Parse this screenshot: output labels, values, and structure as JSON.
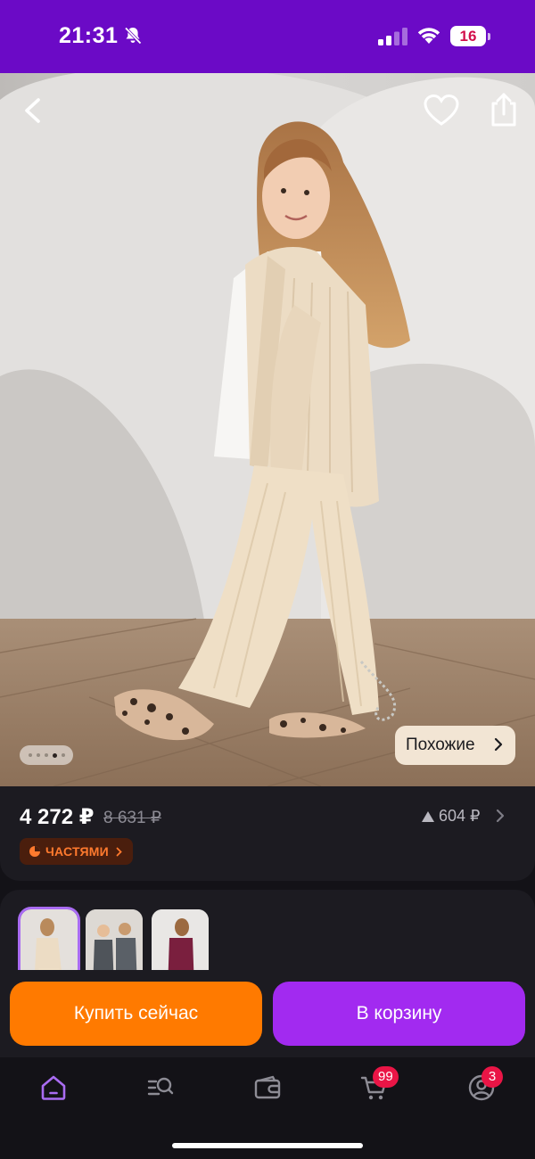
{
  "status_bar": {
    "time": "21:31",
    "battery": "16",
    "icons": [
      "bell-slash-icon",
      "cellular-signal-icon",
      "wifi-icon",
      "battery-icon"
    ],
    "background": "#6b0ac6"
  },
  "product_gallery": {
    "image_description_icon": "product-photo",
    "page_indicator": {
      "total": 5,
      "active": 4
    },
    "similar_label": "Похожие",
    "actions": [
      "back-icon",
      "heart-icon",
      "share-icon"
    ]
  },
  "price": {
    "current": "4 272 ₽",
    "old": "8 631 ₽",
    "change": "604 ₽",
    "installments_label": "ЧАСТЯМИ",
    "accent": "#ff7a2e"
  },
  "variants": {
    "count": 3,
    "selected": 1
  },
  "actions": {
    "buy_now": "Купить сейчас",
    "add_to_cart": "В корзину",
    "buy_color": "#ff7a00",
    "cart_color": "#a22af0"
  },
  "tab_bar": {
    "tabs": [
      {
        "icon": "home-icon",
        "active": true
      },
      {
        "icon": "catalog-search-icon"
      },
      {
        "icon": "wallet-icon"
      },
      {
        "icon": "cart-icon",
        "badge": "99"
      },
      {
        "icon": "profile-icon",
        "badge": "3"
      }
    ],
    "active_color": "#a96cf2",
    "badge_color": "#ea1546"
  }
}
